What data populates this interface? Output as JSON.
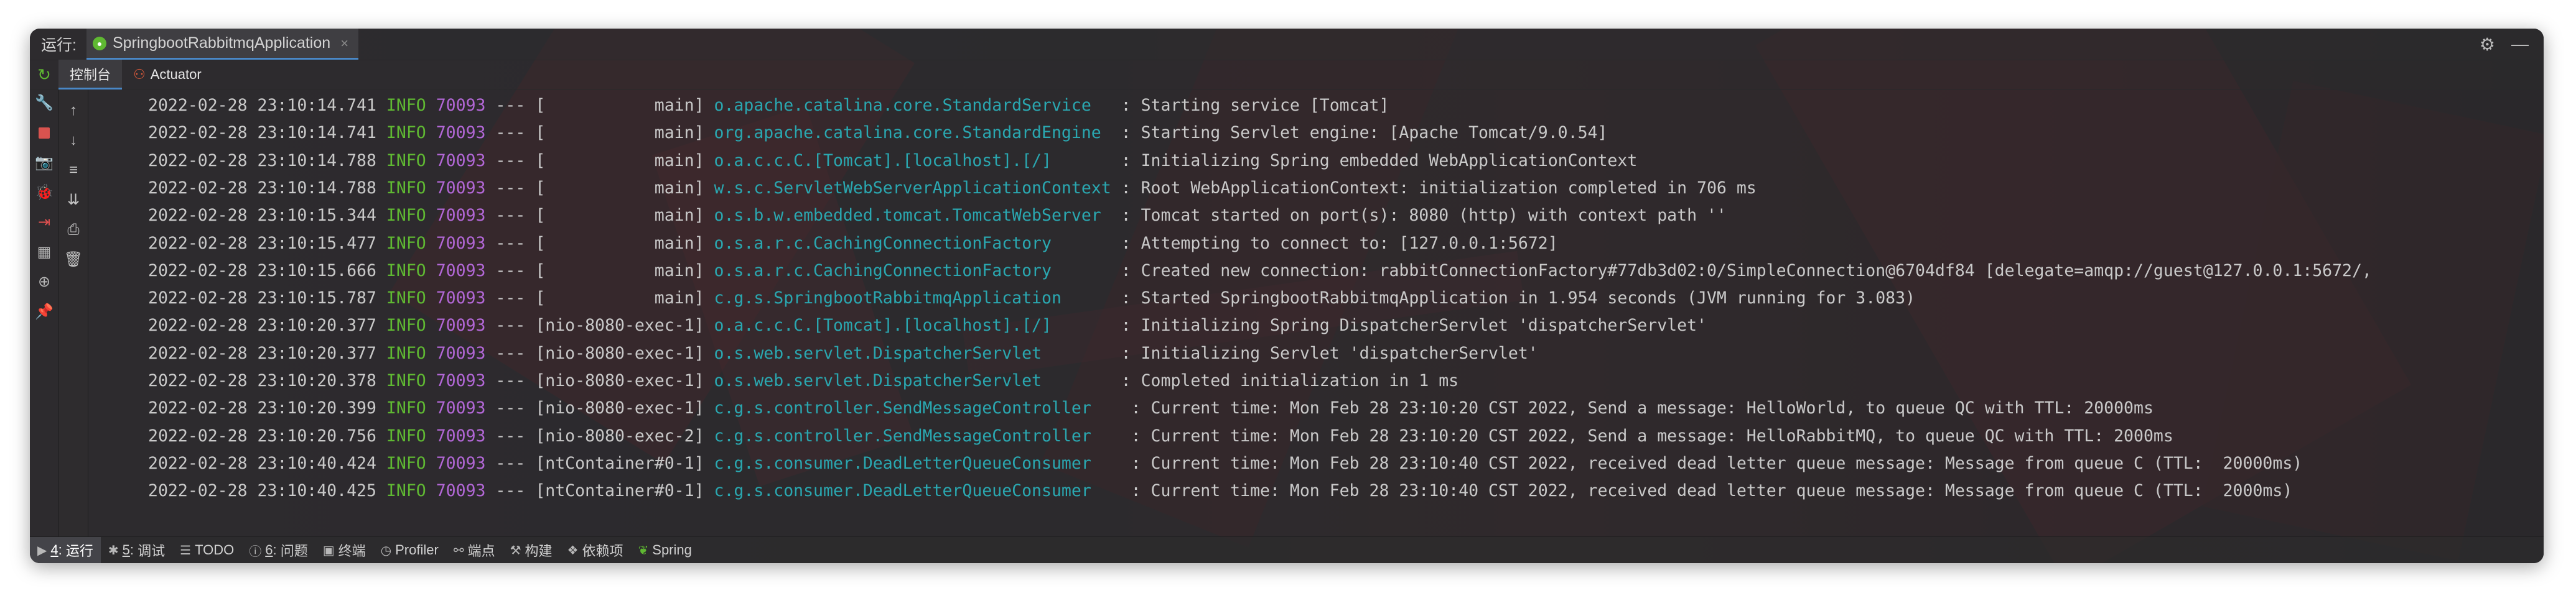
{
  "titlebar": {
    "run_label": "运行:",
    "tab_title": "SpringbootRabbitmqApplication",
    "tab_close": "×",
    "settings_glyph": "⚙",
    "minimize_glyph": "—"
  },
  "subbar": {
    "console_tab": "控制台",
    "actuator_tab": "Actuator"
  },
  "icons": {
    "rerun": "↻",
    "wrench": "🔧",
    "stop": "■",
    "camera": "📷",
    "debug": "🐞",
    "exit": "⇥",
    "layout": "▦",
    "globe": "⊕",
    "pin": "📌",
    "up": "↑",
    "down": "↓",
    "wrap": "≡",
    "scroll_end": "⇊",
    "print": "⎙",
    "trash": "🗑"
  },
  "log_lines": [
    {
      "ts": "2022-02-28 23:10:14.741",
      "level": "INFO",
      "pid": "70093",
      "sep": "---",
      "thread": "[           main]",
      "logger": "o.apache.catalina.core.StandardService  ",
      "message": ": Starting service [Tomcat]"
    },
    {
      "ts": "2022-02-28 23:10:14.741",
      "level": "INFO",
      "pid": "70093",
      "sep": "---",
      "thread": "[           main]",
      "logger": "org.apache.catalina.core.StandardEngine ",
      "message": ": Starting Servlet engine: [Apache Tomcat/9.0.54]"
    },
    {
      "ts": "2022-02-28 23:10:14.788",
      "level": "INFO",
      "pid": "70093",
      "sep": "---",
      "thread": "[           main]",
      "logger": "o.a.c.c.C.[Tomcat].[localhost].[/]      ",
      "message": ": Initializing Spring embedded WebApplicationContext"
    },
    {
      "ts": "2022-02-28 23:10:14.788",
      "level": "INFO",
      "pid": "70093",
      "sep": "---",
      "thread": "[           main]",
      "logger": "w.s.c.ServletWebServerApplicationContext",
      "message": ": Root WebApplicationContext: initialization completed in 706 ms"
    },
    {
      "ts": "2022-02-28 23:10:15.344",
      "level": "INFO",
      "pid": "70093",
      "sep": "---",
      "thread": "[           main]",
      "logger": "o.s.b.w.embedded.tomcat.TomcatWebServer ",
      "message": ": Tomcat started on port(s): 8080 (http) with context path ''"
    },
    {
      "ts": "2022-02-28 23:10:15.477",
      "level": "INFO",
      "pid": "70093",
      "sep": "---",
      "thread": "[           main]",
      "logger": "o.s.a.r.c.CachingConnectionFactory      ",
      "message": ": Attempting to connect to: [127.0.0.1:5672]"
    },
    {
      "ts": "2022-02-28 23:10:15.666",
      "level": "INFO",
      "pid": "70093",
      "sep": "---",
      "thread": "[           main]",
      "logger": "o.s.a.r.c.CachingConnectionFactory      ",
      "message": ": Created new connection: rabbitConnectionFactory#77db3d02:0/SimpleConnection@6704df84 [delegate=amqp://guest@127.0.0.1:5672/,"
    },
    {
      "ts": "2022-02-28 23:10:15.787",
      "level": "INFO",
      "pid": "70093",
      "sep": "---",
      "thread": "[           main]",
      "logger": "c.g.s.SpringbootRabbitmqApplication     ",
      "message": ": Started SpringbootRabbitmqApplication in 1.954 seconds (JVM running for 3.083)"
    },
    {
      "ts": "2022-02-28 23:10:20.377",
      "level": "INFO",
      "pid": "70093",
      "sep": "---",
      "thread": "[nio-8080-exec-1]",
      "logger": "o.a.c.c.C.[Tomcat].[localhost].[/]      ",
      "message": ": Initializing Spring DispatcherServlet 'dispatcherServlet'"
    },
    {
      "ts": "2022-02-28 23:10:20.377",
      "level": "INFO",
      "pid": "70093",
      "sep": "---",
      "thread": "[nio-8080-exec-1]",
      "logger": "o.s.web.servlet.DispatcherServlet       ",
      "message": ": Initializing Servlet 'dispatcherServlet'"
    },
    {
      "ts": "2022-02-28 23:10:20.378",
      "level": "INFO",
      "pid": "70093",
      "sep": "---",
      "thread": "[nio-8080-exec-1]",
      "logger": "o.s.web.servlet.DispatcherServlet       ",
      "message": ": Completed initialization in 1 ms"
    },
    {
      "ts": "2022-02-28 23:10:20.399",
      "level": "INFO",
      "pid": "70093",
      "sep": "---",
      "thread": "[nio-8080-exec-1]",
      "logger": "c.g.s.controller.SendMessageController   ",
      "message": ": Current time: Mon Feb 28 23:10:20 CST 2022, Send a message: HelloWorld, to queue QC with TTL: 20000ms"
    },
    {
      "ts": "2022-02-28 23:10:20.756",
      "level": "INFO",
      "pid": "70093",
      "sep": "---",
      "thread": "[nio-8080-exec-2]",
      "logger": "c.g.s.controller.SendMessageController   ",
      "message": ": Current time: Mon Feb 28 23:10:20 CST 2022, Send a message: HelloRabbitMQ, to queue QC with TTL: 2000ms"
    },
    {
      "ts": "2022-02-28 23:10:40.424",
      "level": "INFO",
      "pid": "70093",
      "sep": "---",
      "thread": "[ntContainer#0-1]",
      "logger": "c.g.s.consumer.DeadLetterQueueConsumer   ",
      "message": ": Current time: Mon Feb 28 23:10:40 CST 2022, received dead letter queue message: Message from queue C (TTL:  20000ms)"
    },
    {
      "ts": "2022-02-28 23:10:40.425",
      "level": "INFO",
      "pid": "70093",
      "sep": "---",
      "thread": "[ntContainer#0-1]",
      "logger": "c.g.s.consumer.DeadLetterQueueConsumer   ",
      "message": ": Current time: Mon Feb 28 23:10:40 CST 2022, received dead letter queue message: Message from queue C (TTL:  2000ms)"
    }
  ],
  "bottombar": {
    "run": {
      "num": "4",
      "label": "运行"
    },
    "debug": {
      "num": "5",
      "label": "调试"
    },
    "todo": "TODO",
    "problems": {
      "num": "6",
      "label": "问题"
    },
    "terminal": "终端",
    "profiler": "Profiler",
    "endpoints": "端点",
    "build": "构建",
    "deps": "依赖项",
    "spring": "Spring"
  }
}
